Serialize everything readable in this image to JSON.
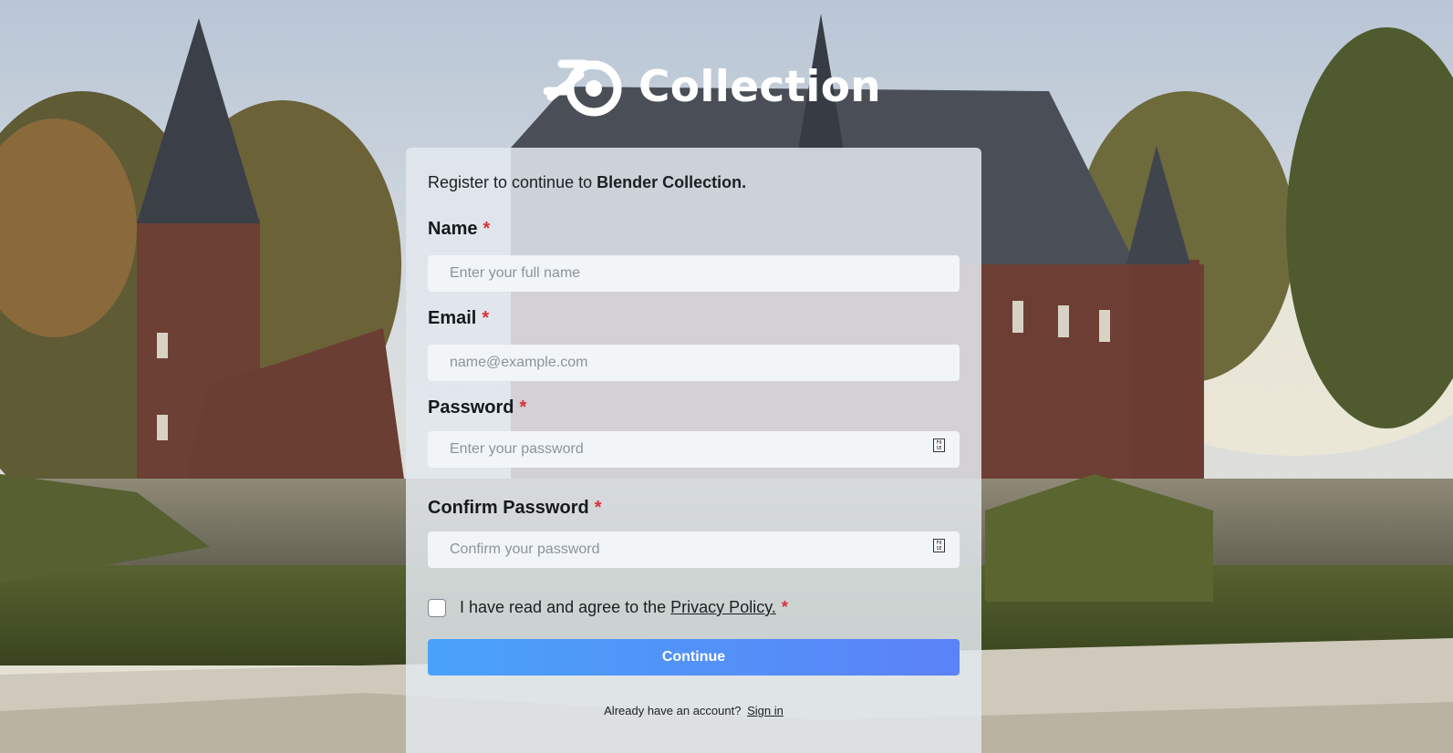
{
  "header": {
    "logo_icon": "blender-logo-icon",
    "logo_text": "Collection"
  },
  "form": {
    "intro_prefix": "Register to continue to ",
    "intro_brand": "Blender Collection.",
    "required_mark": "*",
    "name": {
      "label": "Name",
      "placeholder": "Enter your full name"
    },
    "email": {
      "label": "Email",
      "placeholder": "name@example.com"
    },
    "password": {
      "label": "Password",
      "placeholder": "Enter your password",
      "icon": "show-password-icon"
    },
    "confirm_password": {
      "label": "Confirm Password",
      "placeholder": "Confirm your password",
      "icon": "show-password-icon"
    },
    "agree_prefix": "I have read and agree to the",
    "privacy_link": "Privacy Policy.",
    "continue_label": "Continue",
    "signin_prefix": "Already have an account?",
    "signin_link": "Sign in"
  },
  "colors": {
    "button_gradient_start": "#49a2f9",
    "button_gradient_end": "#5b82f7",
    "required": "#d9303a",
    "card": "#e2e8ee"
  }
}
